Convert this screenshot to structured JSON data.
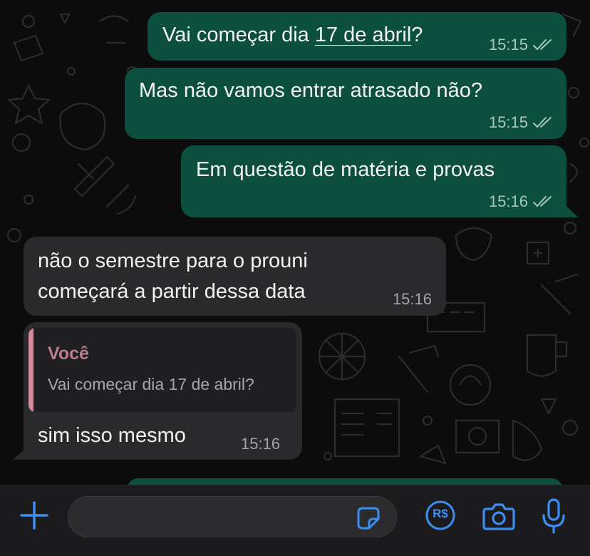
{
  "messages": [
    {
      "id": "m1",
      "direction": "outgoing",
      "text_before": "Vai começar dia ",
      "text_link": "17 de abril",
      "text_after": "?",
      "time": "15:15",
      "status": "read"
    },
    {
      "id": "m2",
      "direction": "outgoing",
      "text": "Mas não vamos entrar atrasado não?",
      "time": "15:15",
      "status": "read"
    },
    {
      "id": "m3",
      "direction": "outgoing",
      "text": "Em questão de matéria e provas",
      "time": "15:16",
      "status": "read"
    },
    {
      "id": "m4",
      "direction": "incoming",
      "lines": [
        "não o semestre para o prouni",
        "começará a partir dessa data"
      ],
      "time": "15:16"
    },
    {
      "id": "m5",
      "direction": "incoming",
      "reply_to": {
        "author": "Você",
        "text": "Vai começar dia 17 de abril?"
      },
      "text": "sim isso mesmo",
      "time": "15:16"
    }
  ],
  "composer": {
    "placeholder": "",
    "value": "",
    "icons": [
      "plus-icon",
      "sticker-icon",
      "payment-icon",
      "camera-icon",
      "microphone-icon"
    ],
    "payment_label": "R$"
  },
  "colors": {
    "outgoing_bubble": "#0c4f3e",
    "incoming_bubble": "#2a2a2c",
    "accent": "#3c8ef2",
    "read_ticks": "#a6c7bd",
    "quote_author": "#b97d8c"
  }
}
